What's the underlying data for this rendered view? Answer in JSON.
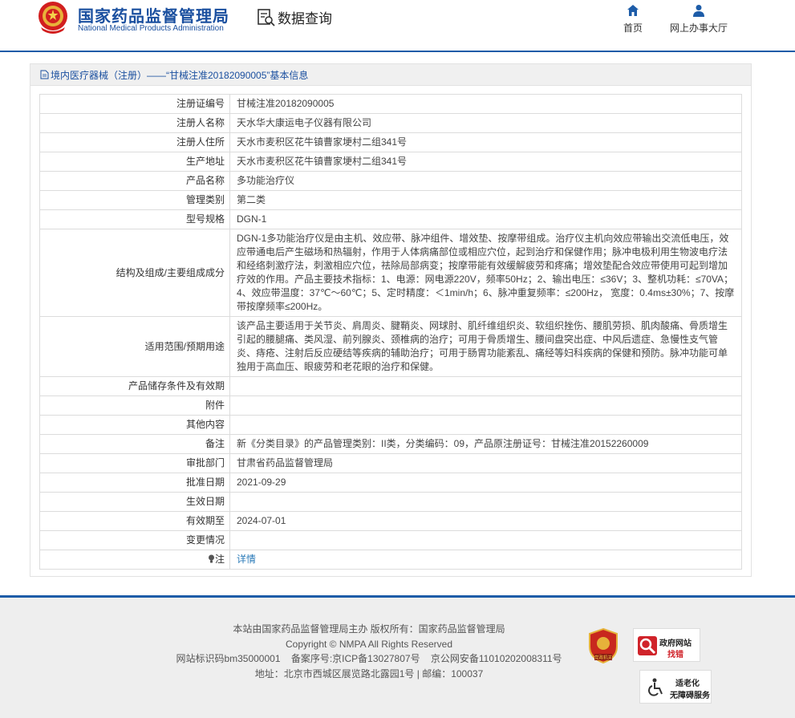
{
  "header": {
    "site_name_cn": "国家药品监督管理局",
    "site_name_en": "National Medical Products Administration",
    "query_label": "数据查询",
    "nav": [
      {
        "label": "首页",
        "icon": "home-icon"
      },
      {
        "label": "网上办事大厅",
        "icon": "user-icon"
      }
    ]
  },
  "panel": {
    "title": "境内医疗器械（注册）——“甘械注准20182090005”基本信息"
  },
  "rows": [
    {
      "label": "注册证编号",
      "value": "甘械注准20182090005"
    },
    {
      "label": "注册人名称",
      "value": "天水华大康运电子仪器有限公司"
    },
    {
      "label": "注册人住所",
      "value": "天水市麦积区花牛镇曹家埂村二组341号"
    },
    {
      "label": "生产地址",
      "value": "天水市麦积区花牛镇曹家埂村二组341号"
    },
    {
      "label": "产品名称",
      "value": "多功能治疗仪"
    },
    {
      "label": "管理类别",
      "value": "第二类"
    },
    {
      "label": "型号规格",
      "value": "DGN-1"
    },
    {
      "label": "结构及组成/主要组成成分",
      "value": "DGN-1多功能治疗仪是由主机、效应带、脉冲组件、增效垫、按摩带组成。治疗仪主机向效应带输出交流低电压，效应带通电后产生磁场和热辐射，作用于人体病痛部位或相应穴位，起到治疗和保健作用；脉冲电极利用生物波电疗法和经络刺激疗法，刺激相应穴位，祛除局部病变；按摩带能有效缓解疲劳和疼痛；增效垫配合效应带使用可起到增加疗效的作用。产品主要技术指标：1、电源：网电源220V，频率50Hz；2、输出电压：≤36V；3、整机功耗：≤70VA；4、效应带温度：37℃～60℃；5、定时精度：＜1min/h；6、脉冲重复频率：≤200Hz， 宽度：0.4ms±30%；7、按摩带按摩频率≤200Hz。"
    },
    {
      "label": "适用范围/预期用途",
      "value": "该产品主要适用于关节炎、肩周炎、腱鞘炎、网球肘、肌纤维组织炎、软组织挫伤、腰肌劳损、肌肉酸痛、骨质增生引起的腰腿痛、类风湿、前列腺炎、颈椎病的治疗；可用于骨质增生、腰间盘突出症、中风后遗症、急慢性支气管炎、痔疮、注射后反应硬结等疾病的辅助治疗；可用于肠胃功能紊乱、痛经等妇科疾病的保健和预防。脉冲功能可单独用于高血压、眼疲劳和老花眼的治疗和保健。"
    },
    {
      "label": "产品储存条件及有效期",
      "value": ""
    },
    {
      "label": "附件",
      "value": ""
    },
    {
      "label": "其他内容",
      "value": ""
    },
    {
      "label": "备注",
      "value": "新《分类目录》的产品管理类别：II类，分类编码：09，产品原注册证号：甘械注准20152260009"
    },
    {
      "label": "审批部门",
      "value": "甘肃省药品监督管理局"
    },
    {
      "label": "批准日期",
      "value": "2021-09-29"
    },
    {
      "label": "生效日期",
      "value": ""
    },
    {
      "label": "有效期至",
      "value": "2024-07-01"
    },
    {
      "label": "变更情况",
      "value": ""
    }
  ],
  "note_row": {
    "label": "注",
    "link": "详情"
  },
  "footer": {
    "lines": [
      "本站由国家药品监督管理局主办 版权所有：国家药品监督管理局",
      "Copyright © NMPA All Rights Reserved",
      "网站标识码bm35000001    备案序号:京ICP备13027807号    京公网安备11010202008311号",
      "地址：北京市西城区展览路北露园1号 | 邮编：100037"
    ],
    "badge_party": "党政机关",
    "badge_gov": "政府网站",
    "badge_gov_sub": "找错",
    "badge_access": "适老化",
    "badge_access_sub": "无障碍服务"
  },
  "colors": {
    "brand": "#1a4f9f",
    "link": "#2a7ab8",
    "panel_header": "#f0f0f0"
  }
}
